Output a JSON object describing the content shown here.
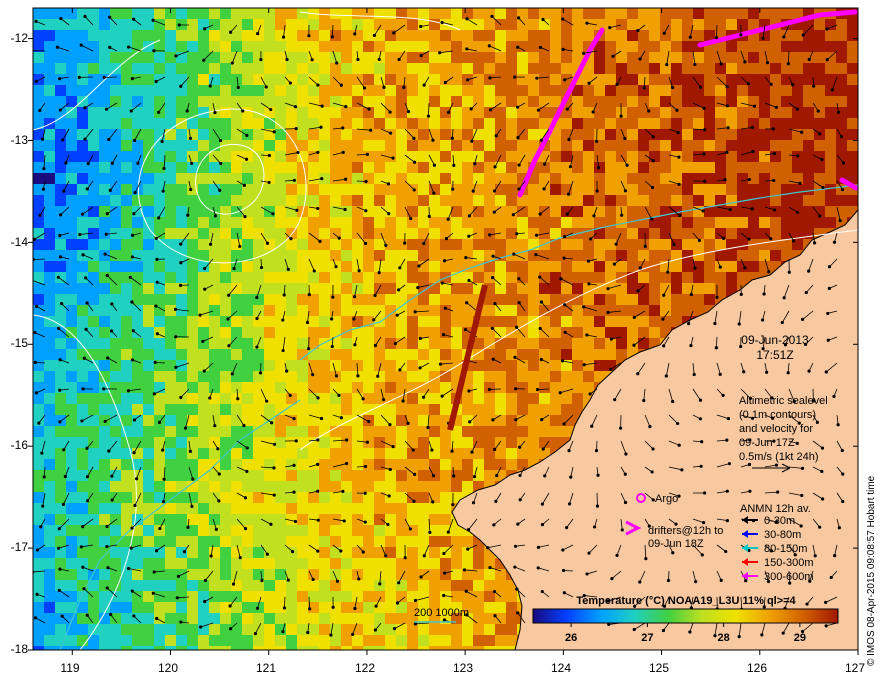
{
  "map": {
    "date": "09-Jun-2013",
    "time": "17:51Z",
    "lon_ticks": [
      "119",
      "120",
      "121",
      "122",
      "123",
      "124",
      "125",
      "126",
      "127"
    ],
    "lat_ticks": [
      "-12",
      "-13",
      "-14",
      "-15",
      "-16",
      "-17",
      "-18"
    ],
    "lon_range": [
      118.6,
      127.0
    ],
    "lat_range": [
      -18.0,
      -11.7
    ]
  },
  "legend": {
    "altimetric": [
      "Altimetric sealevel",
      "(0.1m contours)",
      "and velocity for",
      "09-Jun 17Z",
      "0.5m/s (1kt 24h)"
    ],
    "argo_label": "Argo",
    "drifters": [
      "drifters@12h to",
      "09-Jun 18Z"
    ],
    "anmn_title": "ANMN 12h av.",
    "anmn_items": [
      {
        "label": "0-30m",
        "color": "#000000"
      },
      {
        "label": "30-80m",
        "color": "#0000ff"
      },
      {
        "label": "80-150m",
        "color": "#00c8c8"
      },
      {
        "label": "150-300m",
        "color": "#ff0000"
      },
      {
        "label": "300-600m",
        "color": "#ff00ff"
      }
    ],
    "isobath_label": "200  1000m"
  },
  "colorbar": {
    "title": "Temperature (°C) NOAA19_L3U 11% ql>=4",
    "ticks": [
      "26",
      "27",
      "28",
      "29"
    ],
    "range": [
      25.5,
      29.5
    ],
    "stops": [
      "#1a0a80",
      "#0040ff",
      "#00a0ff",
      "#20d0c0",
      "#40d040",
      "#c0e020",
      "#f0e000",
      "#f0a000",
      "#d06000",
      "#a01800"
    ]
  },
  "credit": "© IMOS 08-Apr-2015 09:08:57 Hobart time",
  "colors": {
    "land": "#f8c8a0",
    "drifter": "#ff00ff",
    "isobath": "#40c8d0",
    "contour": "#ffffff"
  }
}
